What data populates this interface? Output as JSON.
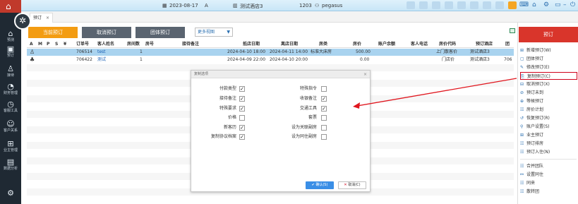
{
  "topbar": {
    "date": "2023-08-17",
    "shift": "A",
    "hotel": "测试酒店3",
    "room_no": "1203",
    "user": "pegasus"
  },
  "tabs": [
    {
      "label": "预订",
      "close": "×"
    }
  ],
  "leftnav": [
    {
      "icon": "⌂",
      "label": "预测"
    },
    {
      "icon": "▣",
      "label": "预订"
    },
    {
      "icon": "♙",
      "label": "接待"
    },
    {
      "icon": "◔",
      "label": "财务管理"
    },
    {
      "icon": "◷",
      "label": "客服工具"
    },
    {
      "icon": "☺",
      "label": "客户关系"
    },
    {
      "icon": "⊞",
      "label": "业主管理"
    },
    {
      "icon": "▤",
      "label": "数据分析"
    },
    {
      "icon": "⚙",
      "label": ""
    }
  ],
  "toolbar": {
    "mode_current": "当前预订",
    "mode_cancel": "取消预订",
    "mode_group": "团体预订",
    "view_select": "更多视图"
  },
  "table": {
    "headers": [
      "A",
      "M",
      "P",
      "S",
      "¥",
      "订单号",
      "客人姓名",
      "房间数",
      "房号",
      "接待备注",
      "抵店日期",
      "离店日期",
      "房类",
      "房价",
      "账户余额",
      "客人电话",
      "房价代码",
      "预订酒店",
      "团"
    ],
    "rows": [
      {
        "icon": "♙",
        "order": "706514",
        "name": "test",
        "rooms": "1",
        "arrive": "2024-04-10 18:00",
        "depart": "2024-04-11 14:00",
        "room_type": "标准大床房",
        "rate": "500.00",
        "rate_code": "上门散客价",
        "hotel": "测试酒店3"
      },
      {
        "icon": "♣",
        "order": "706422",
        "name": "测试",
        "rooms": "1",
        "arrive": "2024-04-09 22:00",
        "depart": "2024-04-10 20:00",
        "room_type": "",
        "rate": "0.00",
        "rate_code": "门店价",
        "hotel": "测试酒店3",
        "extra": "706"
      }
    ]
  },
  "dialog": {
    "title": "复制选项",
    "close": "×",
    "left_options": [
      {
        "label": "付款类型",
        "checked": "✓"
      },
      {
        "label": "接待备注",
        "checked": "✓"
      },
      {
        "label": "特殊要求",
        "checked": "✓"
      },
      {
        "label": "价格",
        "checked": ""
      },
      {
        "label": "新客历",
        "checked": "✓"
      },
      {
        "label": "复制协议档案",
        "checked": "✓"
      }
    ],
    "right_options": [
      {
        "label": "特殊指令",
        "checked": ""
      },
      {
        "label": "收银备注",
        "checked": "✓"
      },
      {
        "label": "交通工具",
        "checked": "✓"
      },
      {
        "label": "套票",
        "checked": ""
      },
      {
        "label": "设为关联副房",
        "checked": ""
      },
      {
        "label": "设为同住副房",
        "checked": ""
      }
    ],
    "ok": "确认(S)",
    "cancel": "取消(C)",
    "ok_icon": "✔",
    "cancel_icon": "✕"
  },
  "rightmenu": {
    "header": "预订",
    "items": [
      {
        "icon": "⊞",
        "label": "新增预订(W)"
      },
      {
        "icon": "▢",
        "label": "团体预订"
      },
      {
        "icon": "✎",
        "label": "修改预订(E)"
      },
      {
        "icon": "⎘",
        "label": "复制预订(C)"
      },
      {
        "icon": "⊟",
        "label": "取消预订(X)"
      },
      {
        "icon": "⊘",
        "label": "预订未到"
      },
      {
        "icon": "⊕",
        "label": "等候预订"
      },
      {
        "icon": "☷",
        "label": "房价计划"
      },
      {
        "icon": "↺",
        "label": "恢复预订(R)"
      },
      {
        "icon": "⚲",
        "label": "账户设置(S)"
      },
      {
        "icon": "⊞",
        "label": "业主预订"
      },
      {
        "icon": "☷",
        "label": "预订排房"
      },
      {
        "icon": "☷",
        "label": "预订入住(N)"
      },
      {
        "icon": "☷",
        "label": "合并团队"
      },
      {
        "icon": "⚯",
        "label": "设置同住"
      },
      {
        "icon": "☷",
        "label": "同来"
      },
      {
        "icon": "☷",
        "label": "散转团"
      }
    ]
  },
  "colors": {
    "accent_orange": "#f39c12",
    "brand_red": "#d9352b",
    "nav_dark": "#1f2933",
    "selected_row": "#a9d3ef",
    "link_blue": "#1a5fb4",
    "ok_blue": "#3a8ee6"
  }
}
